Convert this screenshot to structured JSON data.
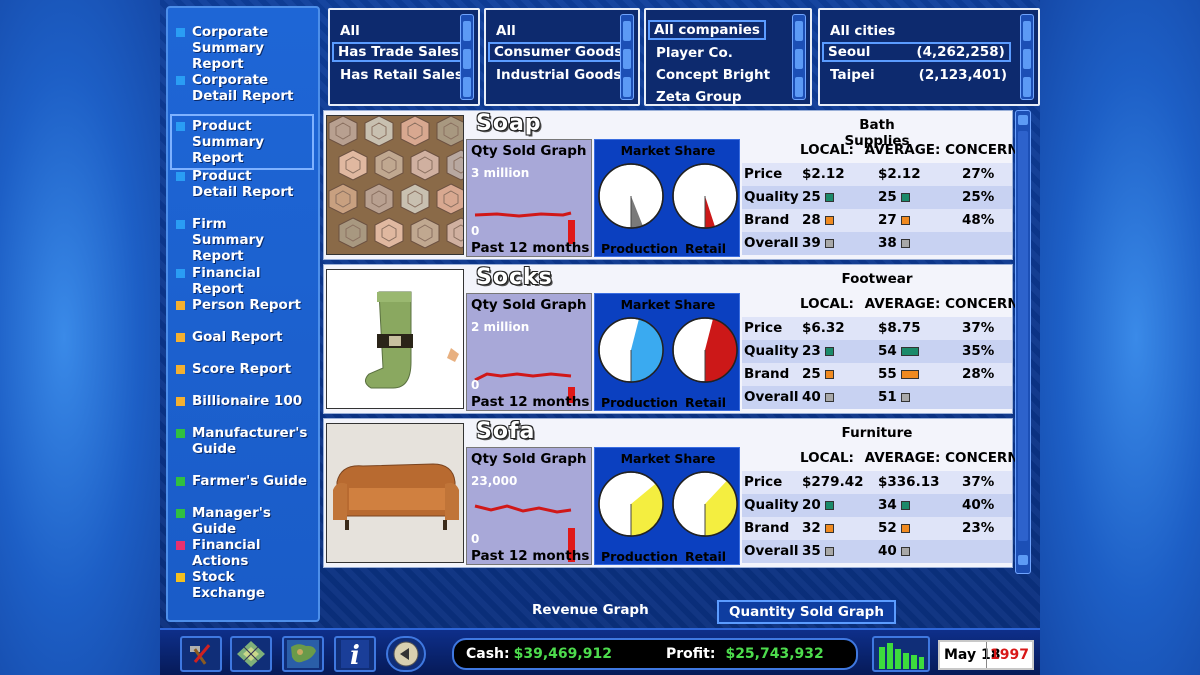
{
  "sidebar": {
    "items": [
      {
        "label": "Corporate\nSummary Report",
        "color": "#2a9df4"
      },
      {
        "label": "Corporate\nDetail Report",
        "color": "#2a9df4"
      },
      {
        "label": "Product\nSummary Report",
        "color": "#2a9df4"
      },
      {
        "label": "Product\nDetail Report",
        "color": "#2a9df4"
      },
      {
        "label": "Firm\nSummary Report",
        "color": "#2a9df4"
      },
      {
        "label": "Financial Report",
        "color": "#2a9df4"
      },
      {
        "label": "Person Report",
        "color": "#f4b030"
      },
      {
        "label": "Goal Report",
        "color": "#f4b030"
      },
      {
        "label": "Score Report",
        "color": "#f4b030"
      },
      {
        "label": "Billionaire 100",
        "color": "#f4b030"
      },
      {
        "label": "Manufacturer's\nGuide",
        "color": "#30c040"
      },
      {
        "label": "Farmer's Guide",
        "color": "#30c040"
      },
      {
        "label": "Manager's Guide",
        "color": "#30c040"
      },
      {
        "label": "Financial Actions",
        "color": "#e83070"
      },
      {
        "label": "Stock Exchange",
        "color": "#f4c020"
      }
    ],
    "active_index": 2
  },
  "filters": {
    "sales": [
      "All",
      "Has Trade Sales",
      "Has Retail Sales"
    ],
    "goods": [
      "All",
      "Consumer Goods",
      "Industrial Goods"
    ],
    "companies": [
      "All companies",
      "Player Co.",
      "Concept Bright",
      "Zeta Group"
    ],
    "cities": [
      {
        "name": "All cities",
        "pop": ""
      },
      {
        "name": "Seoul",
        "pop": "(4,262,258)"
      },
      {
        "name": "Taipei",
        "pop": "(2,123,401)"
      }
    ]
  },
  "products": [
    {
      "name": "Soap",
      "category": "Bath Supplies",
      "qty_title": "Qty Sold Graph",
      "qty_max": "3 million",
      "qty_zero": "0",
      "qty_foot": "Past 12 months",
      "share_title": "Market Share",
      "production_label": "Production",
      "retail_label": "Retail",
      "production_share": 0.06,
      "retail_share": 0.05,
      "pie_color": "#ffffff",
      "pie_fill": "#ffffff",
      "slice_color": "#7a7a7a",
      "slice2_color": "#cc1818",
      "stats_header": [
        "LOCAL:",
        "AVERAGE:",
        "CONCERN:"
      ],
      "rows": [
        {
          "label": "Price",
          "local": "$2.12",
          "avg": "$2.12",
          "concern": "27%",
          "bar": ""
        },
        {
          "label": "Quality",
          "local": "25",
          "avg": "25",
          "concern": "25%",
          "bar": "#1b8a6a"
        },
        {
          "label": "Brand",
          "local": "28",
          "avg": "27",
          "concern": "48%",
          "bar": "#f08a20"
        },
        {
          "label": "Overall",
          "local": "39",
          "avg": "38",
          "concern": "",
          "bar": "#a8a8a8"
        }
      ]
    },
    {
      "name": "Socks",
      "category": "Footwear",
      "qty_title": "Qty Sold Graph",
      "qty_max": "2 million",
      "qty_zero": "0",
      "qty_foot": "Past 12 months",
      "share_title": "Market Share",
      "production_label": "Production",
      "retail_label": "Retail",
      "production_share": 0.46,
      "retail_share": 0.46,
      "pie_color": "#ffffff",
      "pie_fill": "#3aaaf0",
      "slice_color": "#3aaaf0",
      "slice2_color": "#cc1818",
      "stats_header": [
        "LOCAL:",
        "AVERAGE:",
        "CONCERN:"
      ],
      "rows": [
        {
          "label": "Price",
          "local": "$6.32",
          "avg": "$8.75",
          "concern": "37%",
          "bar": ""
        },
        {
          "label": "Quality",
          "local": "23",
          "avg": "54",
          "concern": "35%",
          "bar": "#1b8a6a"
        },
        {
          "label": "Brand",
          "local": "25",
          "avg": "55",
          "concern": "28%",
          "bar": "#f08a20"
        },
        {
          "label": "Overall",
          "local": "40",
          "avg": "51",
          "concern": "",
          "bar": "#a8a8a8"
        }
      ]
    },
    {
      "name": "Sofa",
      "category": "Furniture",
      "qty_title": "Qty Sold Graph",
      "qty_max": "23,000",
      "qty_zero": "0",
      "qty_foot": "Past 12 months",
      "share_title": "Market Share",
      "production_label": "Production",
      "retail_label": "Retail",
      "production_share": 0.36,
      "retail_share": 0.38,
      "pie_color": "#ffffff",
      "pie_fill": "#f4ee40",
      "slice_color": "#f4ee40",
      "slice2_color": "#f4ee40",
      "stats_header": [
        "LOCAL:",
        "AVERAGE:",
        "CONCERN:"
      ],
      "rows": [
        {
          "label": "Price",
          "local": "$279.42",
          "avg": "$336.13",
          "concern": "37%",
          "bar": ""
        },
        {
          "label": "Quality",
          "local": "20",
          "avg": "34",
          "concern": "40%",
          "bar": "#1b8a6a"
        },
        {
          "label": "Brand",
          "local": "32",
          "avg": "52",
          "concern": "23%",
          "bar": "#f08a20"
        },
        {
          "label": "Overall",
          "local": "35",
          "avg": "40",
          "concern": "",
          "bar": "#a8a8a8"
        }
      ]
    }
  ],
  "graph_tabs": {
    "revenue": "Revenue Graph",
    "quantity": "Quantity Sold Graph"
  },
  "status": {
    "cash_label": "Cash:",
    "cash_value": "$39,469,912",
    "profit_label": "Profit:",
    "profit_value": "$25,743,932",
    "date": "May 18",
    "year": "1997"
  },
  "toolbar_icons": [
    "hammer-icon",
    "map-grid-icon",
    "world-map-icon",
    "info-icon",
    "back-arrow-icon"
  ],
  "colors": {
    "money": "#4ddc4d",
    "year": "#d81818",
    "accent": "#5b9cff"
  }
}
